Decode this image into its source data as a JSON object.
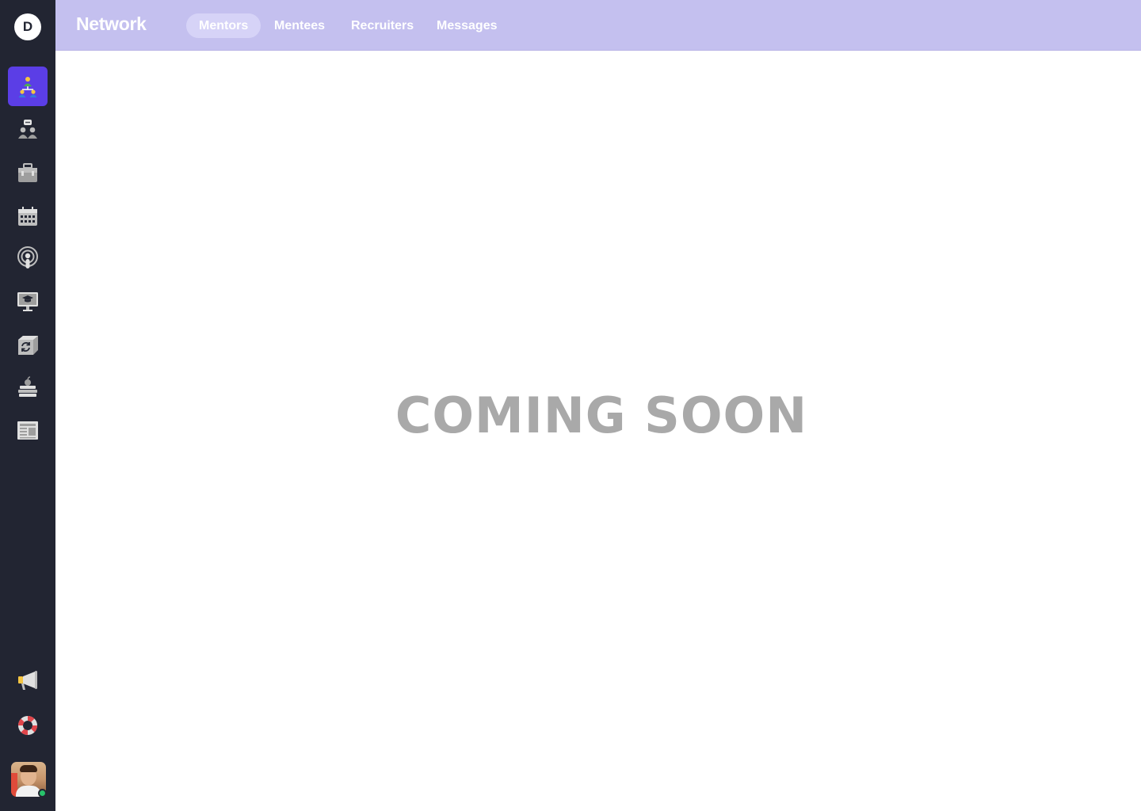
{
  "sidebar": {
    "logo_letter": "D",
    "nav_items": [
      {
        "name": "network",
        "icon": "network-people-icon",
        "active": true
      },
      {
        "name": "community-chat",
        "icon": "people-chat-icon",
        "active": false
      },
      {
        "name": "jobs",
        "icon": "briefcase-icon",
        "active": false
      },
      {
        "name": "events",
        "icon": "calendar-icon",
        "active": false
      },
      {
        "name": "podcasts",
        "icon": "podcast-icon",
        "active": false
      },
      {
        "name": "courses",
        "icon": "graduation-monitor-icon",
        "active": false
      },
      {
        "name": "resources",
        "icon": "cube-sync-icon",
        "active": false
      },
      {
        "name": "learning",
        "icon": "books-apple-icon",
        "active": false
      },
      {
        "name": "news",
        "icon": "newspaper-icon",
        "active": false
      }
    ],
    "bottom_items": [
      {
        "name": "announcements",
        "icon": "megaphone-icon"
      },
      {
        "name": "support",
        "icon": "lifebuoy-icon"
      }
    ],
    "user": {
      "icon": "avatar",
      "status": "online",
      "status_color": "#27c26b"
    }
  },
  "header": {
    "title": "Network",
    "tabs": [
      {
        "label": "Mentors",
        "active": true
      },
      {
        "label": "Mentees",
        "active": false
      },
      {
        "label": "Recruiters",
        "active": false
      },
      {
        "label": "Messages",
        "active": false
      }
    ]
  },
  "main": {
    "message": "COMING SOON"
  },
  "colors": {
    "sidebar_bg": "#222532",
    "header_bg": "#c4c0ef",
    "active_accent": "#5b3ee6",
    "message_text": "#a9a9a9"
  }
}
